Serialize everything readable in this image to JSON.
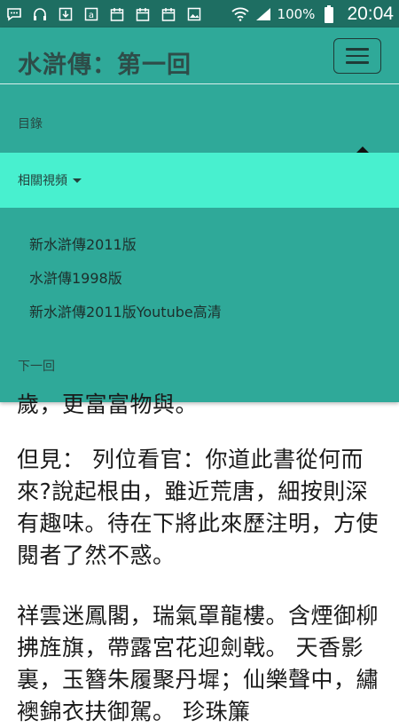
{
  "status_bar": {
    "battery": "100%",
    "time": "20:04",
    "icons": [
      "chat-icon",
      "headset-icon",
      "download-icon",
      "a-icon",
      "calendar-icon",
      "calendar-icon",
      "calendar-icon",
      "image-icon",
      "wifi-icon",
      "signal-icon",
      "battery-icon"
    ]
  },
  "navbar": {
    "brand": "水滸傳：第一回",
    "menu": {
      "toc": "目錄",
      "related_videos": "相關視頻",
      "dropdown_items": [
        "新水滸傳2011版",
        "水滸傳1998版",
        "新水滸傳2011版Youtube高清"
      ],
      "next": "下一回"
    }
  },
  "content": {
    "partial_line": "歲，更富富物與。",
    "paragraph1": "但見： 列位看官：你道此書從何而來?說起根由，雖近荒唐，細按則深有趣味。待在下將此來歷注明，方使閱者了然不惑。",
    "paragraph2": "祥雲迷鳳閣，瑞氣罩龍樓。含煙御柳拂旌旗，帶露宮花迎劍戟。 天香影裏，玉簪朱履聚丹墀；仙樂聲中，繡襖錦衣扶御駕。 珍珠簾"
  }
}
